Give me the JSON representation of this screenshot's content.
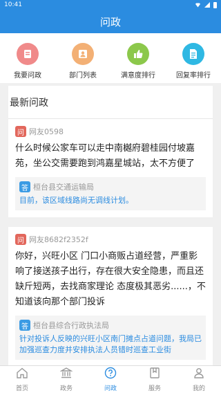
{
  "status_bar": {
    "time": "10:41"
  },
  "title_bar": {
    "title": "问政"
  },
  "quick_nav": [
    {
      "label": "我要问政",
      "icon": "ask-icon",
      "color": "#f08a8a"
    },
    {
      "label": "部门列表",
      "icon": "person-icon",
      "color": "#f3b075"
    },
    {
      "label": "满意度排行",
      "icon": "thumbs-up-icon",
      "color": "#8cc84b"
    },
    {
      "label": "回复率排行",
      "icon": "document-icon",
      "color": "#2fb8e3"
    }
  ],
  "section": {
    "title": "最新问政"
  },
  "tags": {
    "question": "问",
    "answer": "答"
  },
  "posts": [
    {
      "asker": "网友0598",
      "question": "什么时候公家车可以走中南樾府碧桂园付坡嘉苑，坐公交需要跑到鸿嘉星城站，太不方便了",
      "department": "桓台县交通运输局",
      "answer": "目前，该区域线路尚无调线计划。"
    },
    {
      "asker": "网友8682f2352f",
      "question": "你好，兴旺小区 门口小商贩占道经营，严重影响了接送孩子出行，存在很大安全隐患，而且还缺斤短两，去找商家理论 态度极其恶劣......，不知道该向那个部门投诉",
      "department": "桓台县综合行政执法局",
      "answer": "针对投诉人反映的兴旺小区南门摊点占道问题，我局已加强巡查力度并安排执法人员错时巡查工业街"
    }
  ],
  "tab_bar": [
    {
      "label": "首页",
      "icon": "home-icon"
    },
    {
      "label": "政务",
      "icon": "government-icon"
    },
    {
      "label": "问政",
      "icon": "question-icon",
      "active": true
    },
    {
      "label": "服务",
      "icon": "bookmark-icon"
    },
    {
      "label": "我的",
      "icon": "profile-icon"
    }
  ],
  "colors": {
    "accent": "#2b8ce0",
    "question_tag": "#e2675c",
    "answer_tag": "#3b9be4"
  }
}
